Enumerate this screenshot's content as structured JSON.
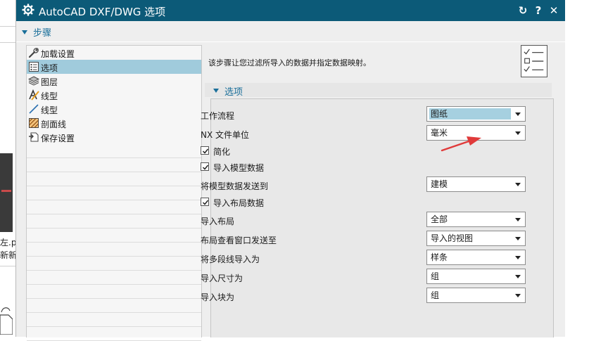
{
  "background_app": {
    "fragments": [
      "左.p",
      "新新"
    ]
  },
  "dialog": {
    "title": "AutoCAD DXF/DWG 选项",
    "buttons": {
      "reset": "↻",
      "help": "?",
      "close": "✕"
    },
    "steps_section": {
      "label": "步骤"
    },
    "steps": [
      {
        "label": "加载设置",
        "icon": "wrench-icon",
        "selected": false
      },
      {
        "label": "选项",
        "icon": "options-list-icon",
        "selected": true
      },
      {
        "label": "图层",
        "icon": "layers-icon",
        "selected": false
      },
      {
        "label": "线型",
        "icon": "linetype-icon",
        "selected": false
      },
      {
        "label": "线型",
        "icon": "line-icon",
        "selected": false
      },
      {
        "label": "剖面线",
        "icon": "hatch-icon",
        "selected": false
      },
      {
        "label": "保存设置",
        "icon": "save-settings-icon",
        "selected": false
      }
    ],
    "description": "该步骤让您过滤所导入的数据并指定数据映射。",
    "options_section": {
      "label": "选项"
    },
    "options": {
      "workflow": {
        "label": "工作流程",
        "value": "图纸"
      },
      "nx_units": {
        "label": "NX 文件单位",
        "value": "毫米"
      },
      "simplify": {
        "label": "简化",
        "checked": true
      },
      "import_model_data": {
        "label": "导入模型数据",
        "checked": true
      },
      "send_model_to": {
        "label": "将模型数据发送到",
        "value": "建模"
      },
      "import_layout_data": {
        "label": "导入布局数据",
        "checked": true
      },
      "import_layout": {
        "label": "导入布局",
        "value": "全部"
      },
      "layout_view_send_to": {
        "label": "布局查看窗口发送至",
        "value": "导入的视图"
      },
      "polyline_as": {
        "label": "将多段线导入为",
        "value": "样条"
      },
      "dimension_as": {
        "label": "导入尺寸为",
        "value": "组"
      },
      "block_as": {
        "label": "导入块为",
        "value": "组"
      }
    }
  },
  "colors": {
    "titlebar": "#0c5a78",
    "accent": "#1a6f9a",
    "selection": "#a0cbdc",
    "annotation_arrow": "#e03a3a"
  }
}
